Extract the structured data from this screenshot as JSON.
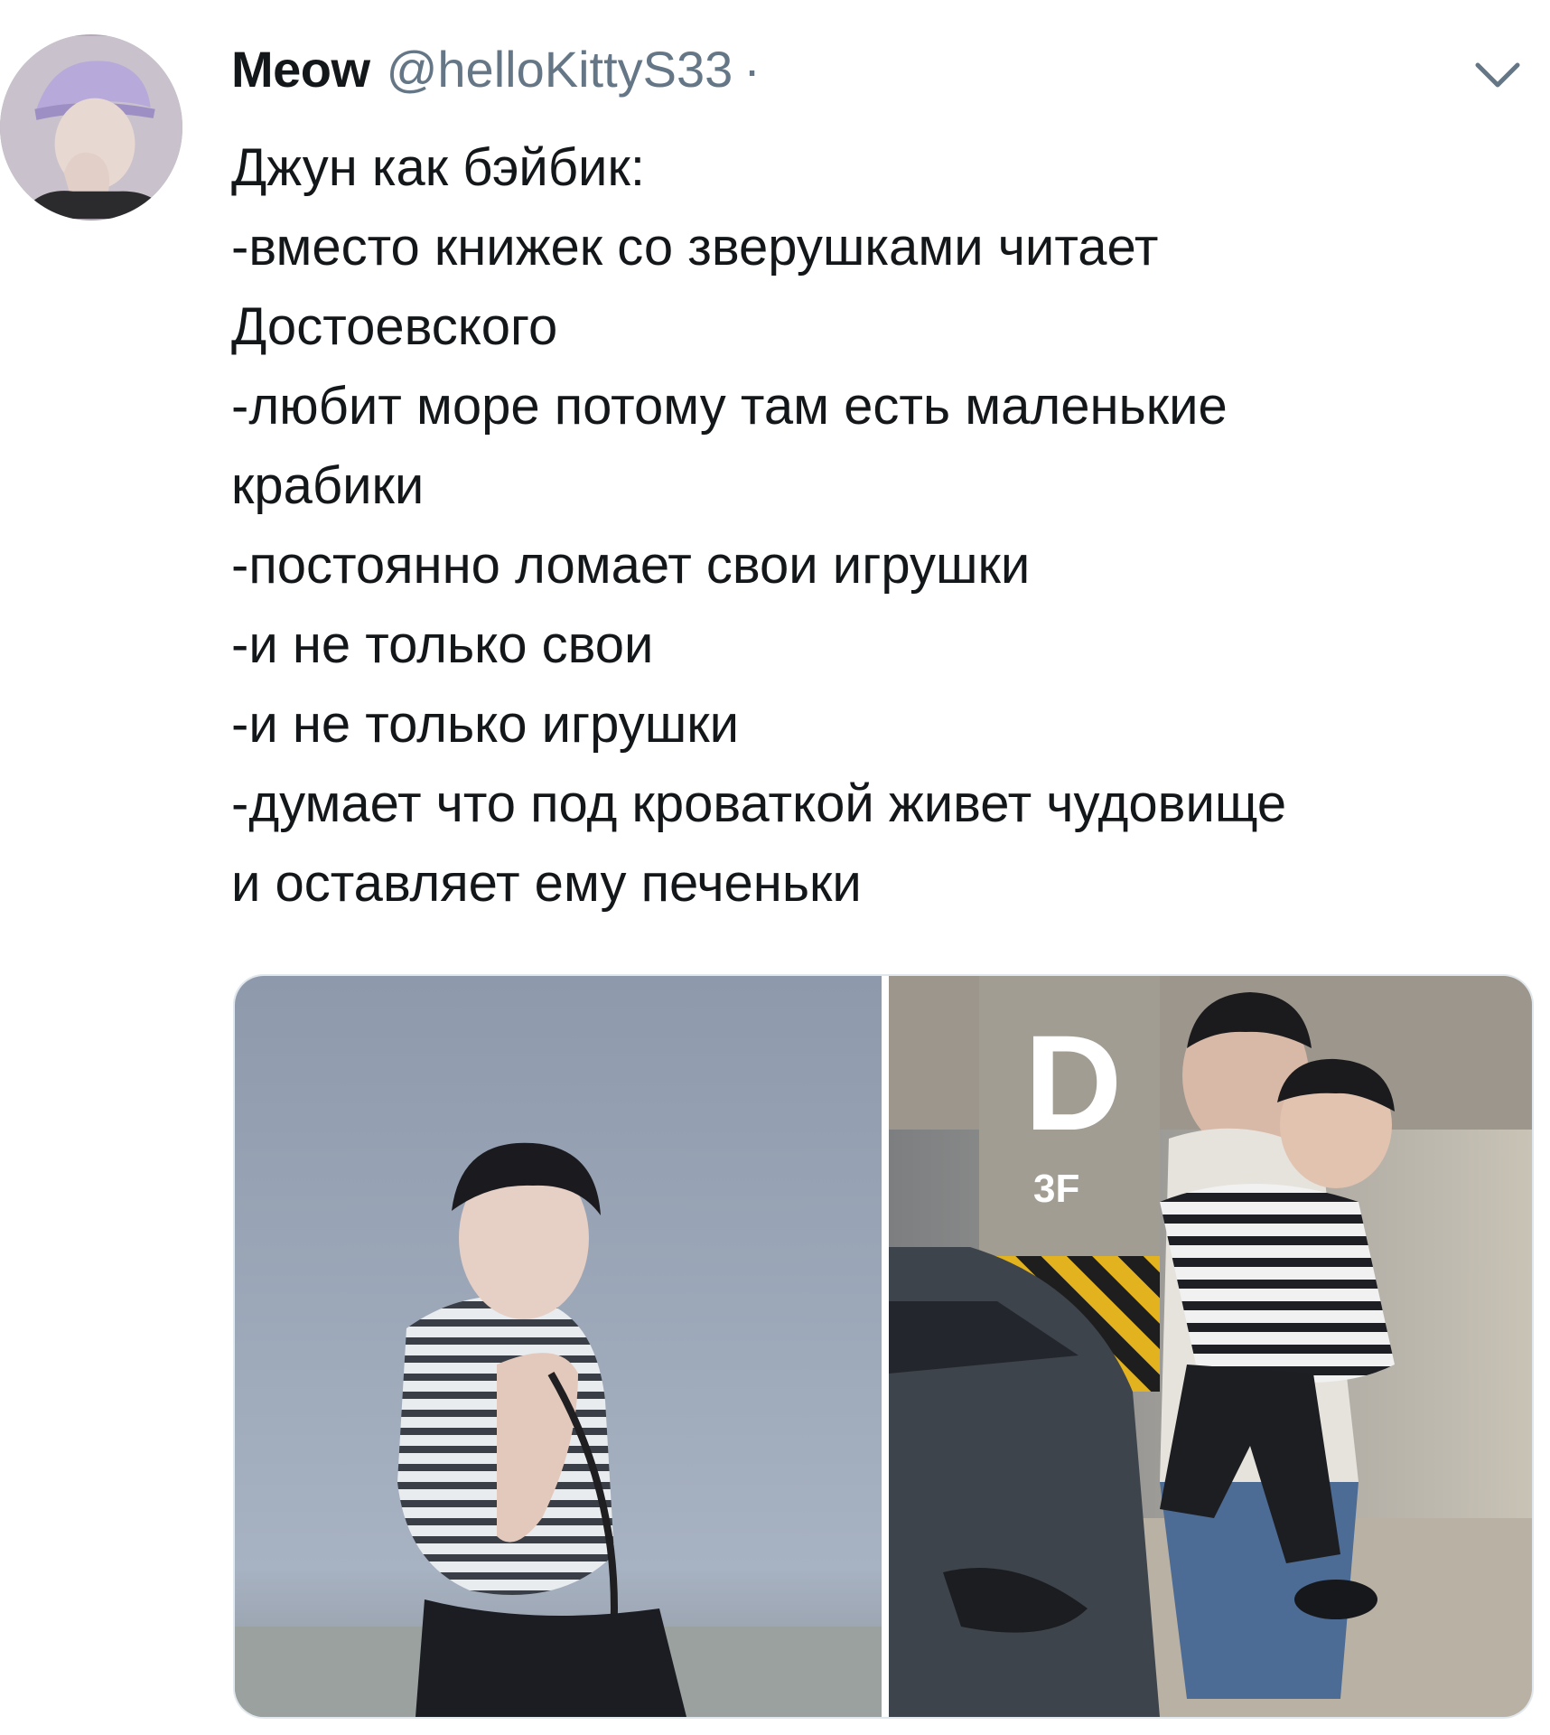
{
  "tweet": {
    "author": {
      "display_name": "Meow",
      "handle": "@helloKittyS33",
      "separator": "·",
      "avatar_icon": "user-avatar-photo"
    },
    "menu_icon": "chevron-down-icon",
    "text_lines": [
      "Джун как бэйбик:",
      "-вместо книжек со зверушками читает",
      "Достоевского",
      "-любит море потому там есть маленькие",
      "крабики",
      "-постоянно ломает свои игрушки",
      "-и не только свои",
      "-и не только игрушки",
      "-думает что под кроваткой живет чудовище",
      "и оставляет ему печеньки"
    ],
    "media": [
      {
        "icon": "photo-man-striped-shirt"
      },
      {
        "icon": "photo-parking-garage",
        "sign_letter": "D",
        "sign_floor": "3F"
      }
    ]
  },
  "colors": {
    "text_primary": "#14171a",
    "text_secondary": "#657786",
    "border": "#e1e8ed"
  }
}
